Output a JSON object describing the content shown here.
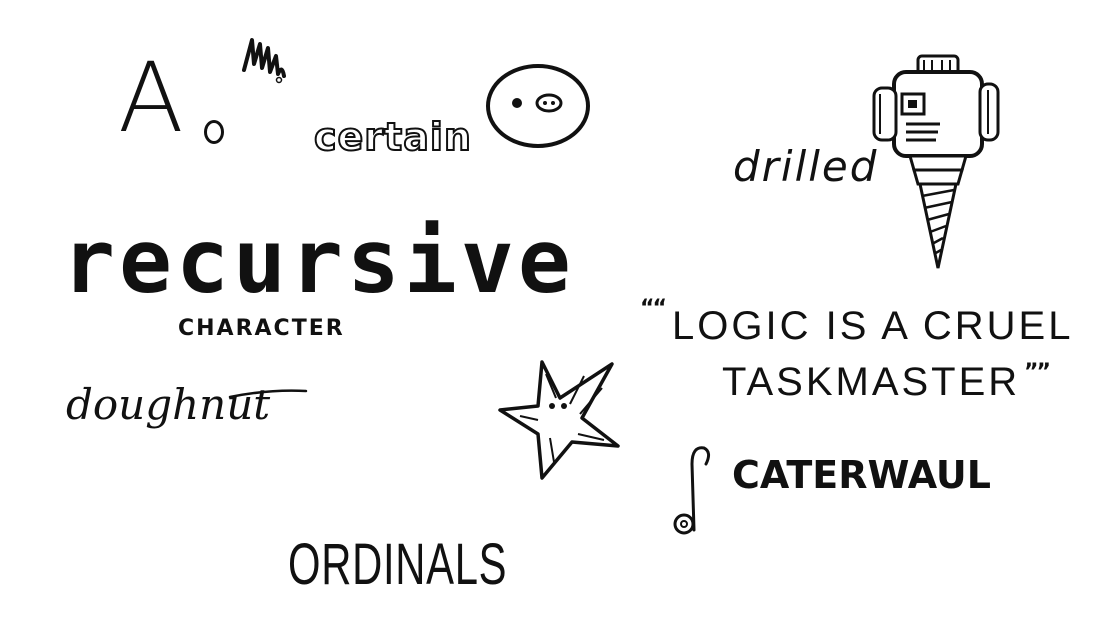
{
  "words": {
    "glyph_a": "A",
    "certain": "certain",
    "drilled": "drilled",
    "recursive": "recursive",
    "character": "CHARACTER",
    "doughnut": "doughnut",
    "quote_line1": "LOGIC IS A CRUEL",
    "quote_line2": "TASKMASTER",
    "caterwaul": "CATERWAUL",
    "ordinals": "ORDINALS"
  },
  "icons": {
    "squiggle": "squiggle-doodle-icon",
    "face": "round-face-doodle-icon",
    "drill": "robot-drill-doodle-icon",
    "star": "star-face-doodle-icon",
    "note": "musical-note-doodle-icon"
  },
  "colors": {
    "ink": "#111111",
    "paper": "#ffffff"
  }
}
